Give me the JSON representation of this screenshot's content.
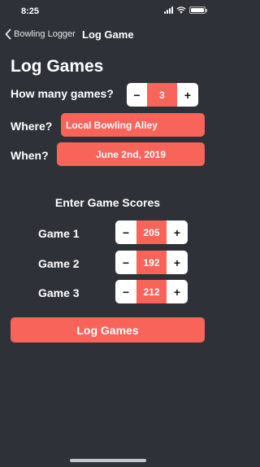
{
  "status_bar": {
    "time": "8:25"
  },
  "nav": {
    "back_label": "Bowling Logger",
    "title": "Log Game"
  },
  "page_title": "Log Games",
  "games_count": {
    "label": "How many games?",
    "value": "3",
    "minus": "−",
    "plus": "+"
  },
  "where": {
    "label": "Where?",
    "value": "Local Bowling Alley"
  },
  "when": {
    "label": "When?",
    "value": "June 2nd, 2019"
  },
  "scores": {
    "heading": "Enter Game Scores",
    "games": [
      {
        "label": "Game 1",
        "score": "205",
        "minus": "−",
        "plus": "+"
      },
      {
        "label": "Game 2",
        "score": "192",
        "minus": "−",
        "plus": "+"
      },
      {
        "label": "Game 3",
        "score": "212",
        "minus": "−",
        "plus": "+"
      }
    ]
  },
  "submit_label": "Log Games",
  "colors": {
    "background": "#2f3138",
    "accent": "#f8635a",
    "button_bg": "#ffffff"
  },
  "icons": [
    "chevron-left-icon",
    "signal-icon",
    "wifi-icon",
    "battery-icon"
  ]
}
